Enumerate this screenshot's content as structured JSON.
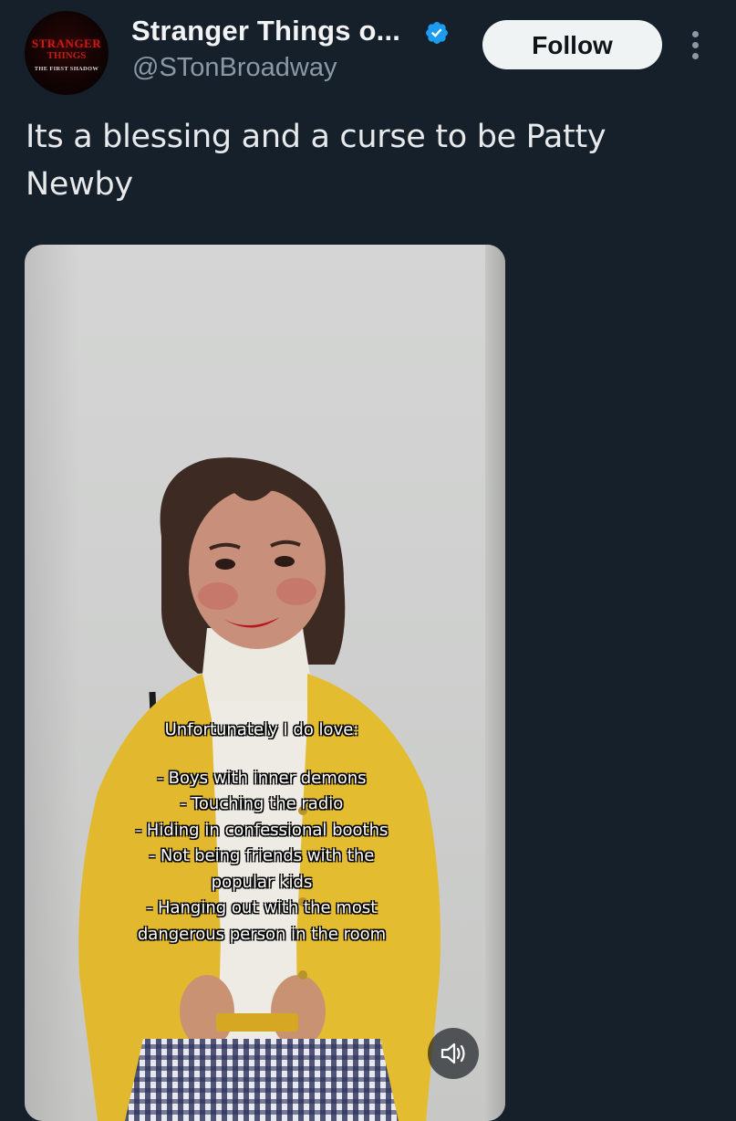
{
  "account": {
    "display_name": "Stranger Things o...",
    "handle": "@STonBroadway",
    "verified": true,
    "avatar_logo": {
      "line1": "STRANGER",
      "line2": "THINGS",
      "line3": "THE FIRST SHADOW"
    }
  },
  "actions": {
    "follow_label": "Follow",
    "more_icon": "more-vertical-icon"
  },
  "tweet": {
    "text": "Its a blessing and a curse to be Patty Newby"
  },
  "media": {
    "type": "video",
    "caption": {
      "heading": "Unfortunately I do love:",
      "lines": [
        "- Boys with inner demons",
        "- Touching the radio",
        "- Hiding in confessional booths",
        "- Not being friends with the",
        "popular kids",
        "- Hanging out with the most",
        "dangerous person in the room"
      ]
    },
    "mute_icon": "volume-icon"
  },
  "colors": {
    "background": "#15202b",
    "verified_blue": "#1d9bf0",
    "follow_bg": "#eff3f4",
    "secondary_text": "#8b98a5"
  }
}
